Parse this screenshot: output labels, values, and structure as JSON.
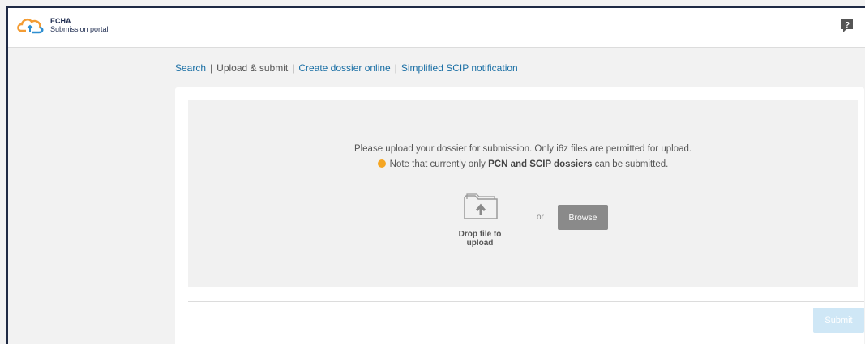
{
  "header": {
    "logo_line1": "ECHA",
    "logo_line2": "Submission portal",
    "logo_icon": "cloud-upload-icon",
    "help_icon": "help-icon",
    "help_glyph": "?"
  },
  "nav": {
    "search": "Search",
    "separator": "|",
    "upload_submit": "Upload & submit",
    "create_dossier": "Create dossier online",
    "scip": "Simplified SCIP notification"
  },
  "upload": {
    "message": "Please upload your dossier for submission. Only i6z files are permitted for upload.",
    "note_prefix": "Note that currently only",
    "note_bold": "PCN and SCIP dossiers",
    "note_suffix": "can be submitted.",
    "drop_label": "Drop file to upload",
    "or_text": "or",
    "browse_label": "Browse",
    "folder_icon": "folder-upload-icon",
    "note_icon": "warning-dot-icon"
  },
  "footer": {
    "submit_label": "Submit"
  },
  "colors": {
    "link": "#1a6fa5",
    "note_dot": "#f5a623",
    "browse_bg": "#8a8a8a",
    "submit_bg": "#cfe7f6"
  }
}
